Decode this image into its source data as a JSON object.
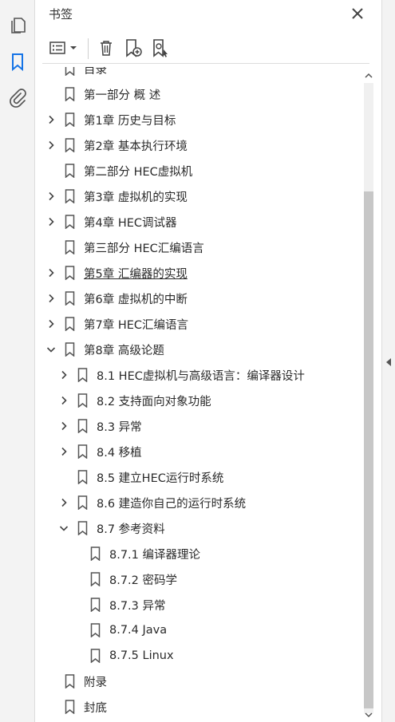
{
  "panel": {
    "title": "书签"
  },
  "left_rail": {
    "items": [
      {
        "name": "pages-icon",
        "active": false
      },
      {
        "name": "bookmark-icon",
        "active": true
      },
      {
        "name": "attachment-icon",
        "active": false
      }
    ]
  },
  "colors": {
    "accent": "#1473e6",
    "icon": "#555555",
    "text": "#2a2a2a"
  },
  "bookmarks": [
    {
      "label": "目录",
      "level": 0,
      "toggle": "none"
    },
    {
      "label": "第一部分 概 述",
      "level": 0,
      "toggle": "none"
    },
    {
      "label": "第1章 历史与目标",
      "level": 0,
      "toggle": "collapsed"
    },
    {
      "label": "第2章 基本执行环境",
      "level": 0,
      "toggle": "collapsed"
    },
    {
      "label": "第二部分 HEC虚拟机",
      "level": 0,
      "toggle": "none"
    },
    {
      "label": "第3章 虚拟机的实现",
      "level": 0,
      "toggle": "collapsed"
    },
    {
      "label": "第4章 HEC调试器",
      "level": 0,
      "toggle": "collapsed"
    },
    {
      "label": "第三部分 HEC汇编语言",
      "level": 0,
      "toggle": "none"
    },
    {
      "label": "第5章 汇编器的实现",
      "level": 0,
      "toggle": "collapsed",
      "underline": true
    },
    {
      "label": "第6章 虚拟机的中断",
      "level": 0,
      "toggle": "collapsed"
    },
    {
      "label": "第7章 HEC汇编语言",
      "level": 0,
      "toggle": "collapsed"
    },
    {
      "label": "第8章 高级论题",
      "level": 0,
      "toggle": "expanded"
    },
    {
      "label": "8.1 HEC虚拟机与高级语言：编译器设计",
      "level": 1,
      "toggle": "collapsed"
    },
    {
      "label": "8.2 支持面向对象功能",
      "level": 1,
      "toggle": "collapsed"
    },
    {
      "label": "8.3 异常",
      "level": 1,
      "toggle": "collapsed"
    },
    {
      "label": "8.4 移植",
      "level": 1,
      "toggle": "collapsed"
    },
    {
      "label": "8.5 建立HEC运行时系统",
      "level": 1,
      "toggle": "none"
    },
    {
      "label": "8.6 建造你自己的运行时系统",
      "level": 1,
      "toggle": "collapsed"
    },
    {
      "label": "8.7 参考资料",
      "level": 1,
      "toggle": "expanded"
    },
    {
      "label": "8.7.1 编译器理论",
      "level": 2,
      "toggle": "none"
    },
    {
      "label": "8.7.2 密码学",
      "level": 2,
      "toggle": "none"
    },
    {
      "label": "8.7.3 异常",
      "level": 2,
      "toggle": "none"
    },
    {
      "label": "8.7.4 Java",
      "level": 2,
      "toggle": "none"
    },
    {
      "label": "8.7.5 Linux",
      "level": 2,
      "toggle": "none"
    },
    {
      "label": "附录",
      "level": 0,
      "toggle": "none"
    },
    {
      "label": "封底",
      "level": 0,
      "toggle": "none"
    }
  ]
}
